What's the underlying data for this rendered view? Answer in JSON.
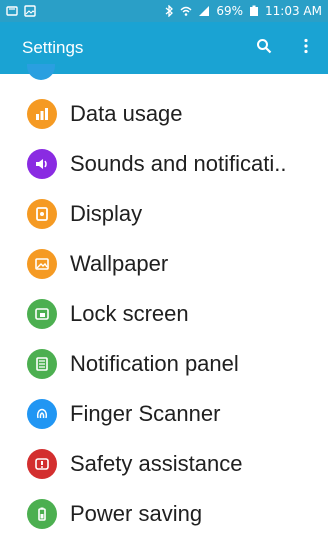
{
  "status_bar": {
    "time": "11:03 AM",
    "battery": "69%",
    "left_icons": [
      "notification-icon",
      "image-icon"
    ],
    "right_icons": [
      "bluetooth-icon",
      "wifi-icon",
      "signal-icon",
      "battery-icon"
    ]
  },
  "app_bar": {
    "title": "Settings",
    "actions": [
      "search-icon",
      "more-vert-icon"
    ],
    "color": "#1aa3d3"
  },
  "settings_items": [
    {
      "label": "Data usage",
      "icon": "data-usage-icon",
      "color": "#f59a23"
    },
    {
      "label": "Sounds and notificati..",
      "icon": "sound-icon",
      "color": "#8a2be2"
    },
    {
      "label": "Display",
      "icon": "display-icon",
      "color": "#f59a23"
    },
    {
      "label": "Wallpaper",
      "icon": "wallpaper-icon",
      "color": "#f59a23"
    },
    {
      "label": "Lock screen",
      "icon": "lock-screen-icon",
      "color": "#4caf50"
    },
    {
      "label": "Notification panel",
      "icon": "notification-panel-icon",
      "color": "#4caf50"
    },
    {
      "label": "Finger Scanner",
      "icon": "fingerprint-icon",
      "color": "#2196f3"
    },
    {
      "label": "Safety assistance",
      "icon": "safety-icon",
      "color": "#d32f2f"
    },
    {
      "label": "Power saving",
      "icon": "battery-saving-icon",
      "color": "#4caf50"
    }
  ]
}
